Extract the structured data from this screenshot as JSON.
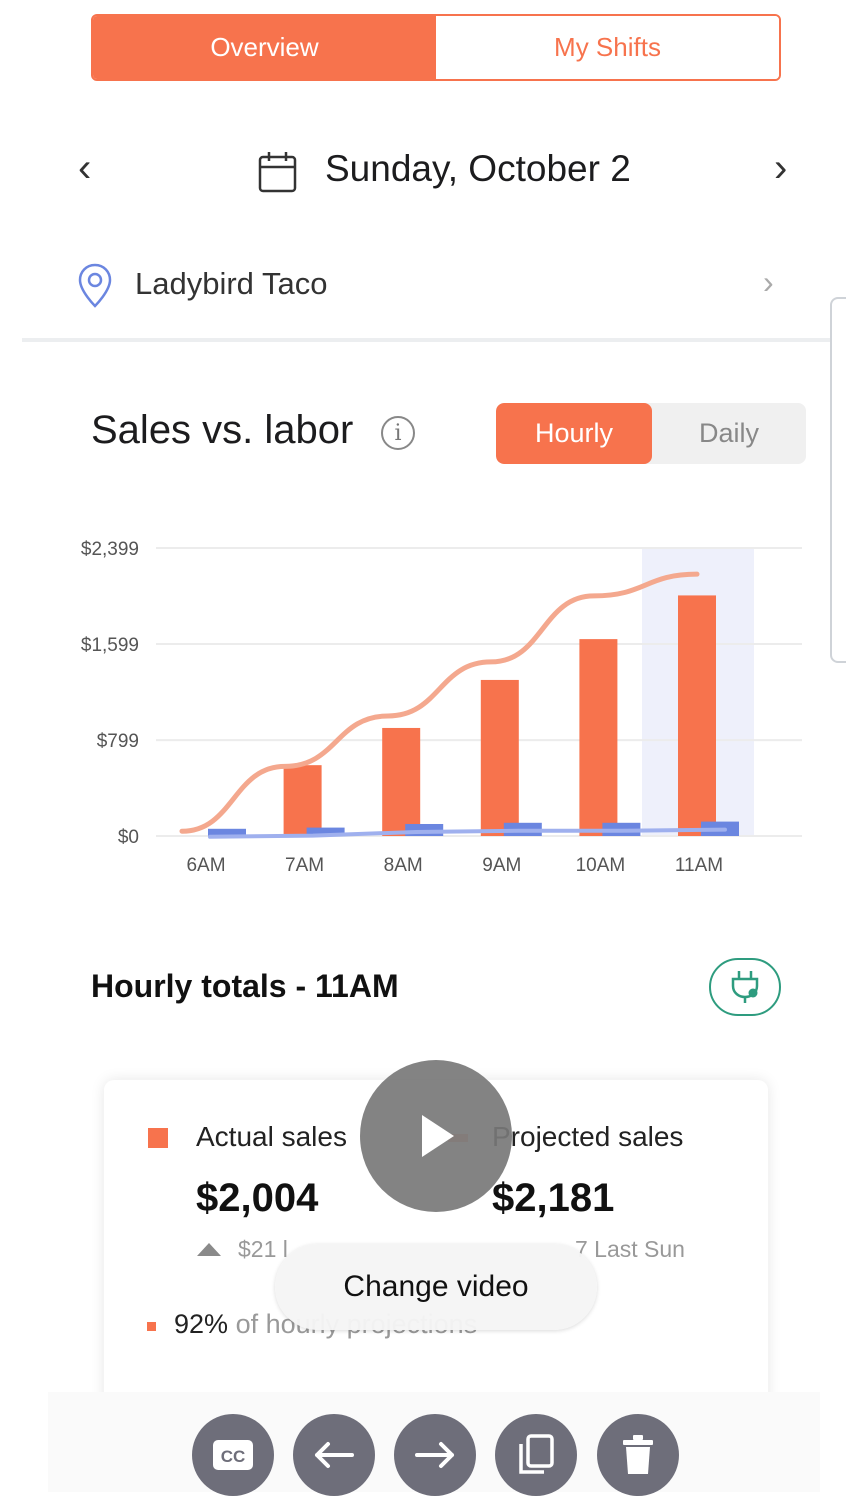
{
  "tabs": {
    "overview": "Overview",
    "my_shifts": "My Shifts"
  },
  "date_nav": {
    "prev": "‹",
    "next": "›",
    "date": "Sunday, October 2"
  },
  "location": {
    "name": "Ladybird Taco",
    "chevron": "›"
  },
  "sales_section": {
    "title": "Sales vs. labor",
    "info": "i",
    "toggle_hourly": "Hourly",
    "toggle_daily": "Daily"
  },
  "colors": {
    "accent": "#f7734d",
    "labor": "#6b86e0",
    "projection": "#f4a88e",
    "teal": "#2e9c7f"
  },
  "chart_data": {
    "type": "bar",
    "categories": [
      "6AM",
      "7AM",
      "8AM",
      "9AM",
      "10AM",
      "11AM"
    ],
    "series": [
      {
        "values": [
          0,
          590,
          900,
          1300,
          1640,
          2004
        ],
        "color": "#f7734d"
      },
      {
        "values": [
          60,
          70,
          100,
          110,
          110,
          120
        ],
        "color": "#6b86e0"
      }
    ],
    "line": {
      "values": [
        40,
        580,
        1000,
        1450,
        2000,
        2181
      ],
      "color": "#f4a88e"
    },
    "yticks": [
      "$0",
      "$799",
      "$1,599",
      "$2,399"
    ],
    "ytick_values": [
      0,
      799,
      1599,
      2399
    ],
    "ylim": [
      0,
      2399
    ],
    "highlight_category": "11AM",
    "grid": true
  },
  "hourly_totals": {
    "title": "Hourly totals - 11AM"
  },
  "card": {
    "actual_label": "Actual sales",
    "actual_value": "$2,004",
    "actual_sub": "$21 l",
    "projected_label": "Projected sales",
    "projected_value": "$2,181",
    "projected_sub": "7 Last Sun",
    "pct_value": "92%",
    "pct_text": "of hourly projections"
  },
  "video": {
    "change_video": "Change video"
  },
  "controls": [
    "cc-icon",
    "arrow-left-icon",
    "arrow-right-icon",
    "copy-icon",
    "trash-icon"
  ],
  "control_labels": {
    "cc": "CC"
  }
}
